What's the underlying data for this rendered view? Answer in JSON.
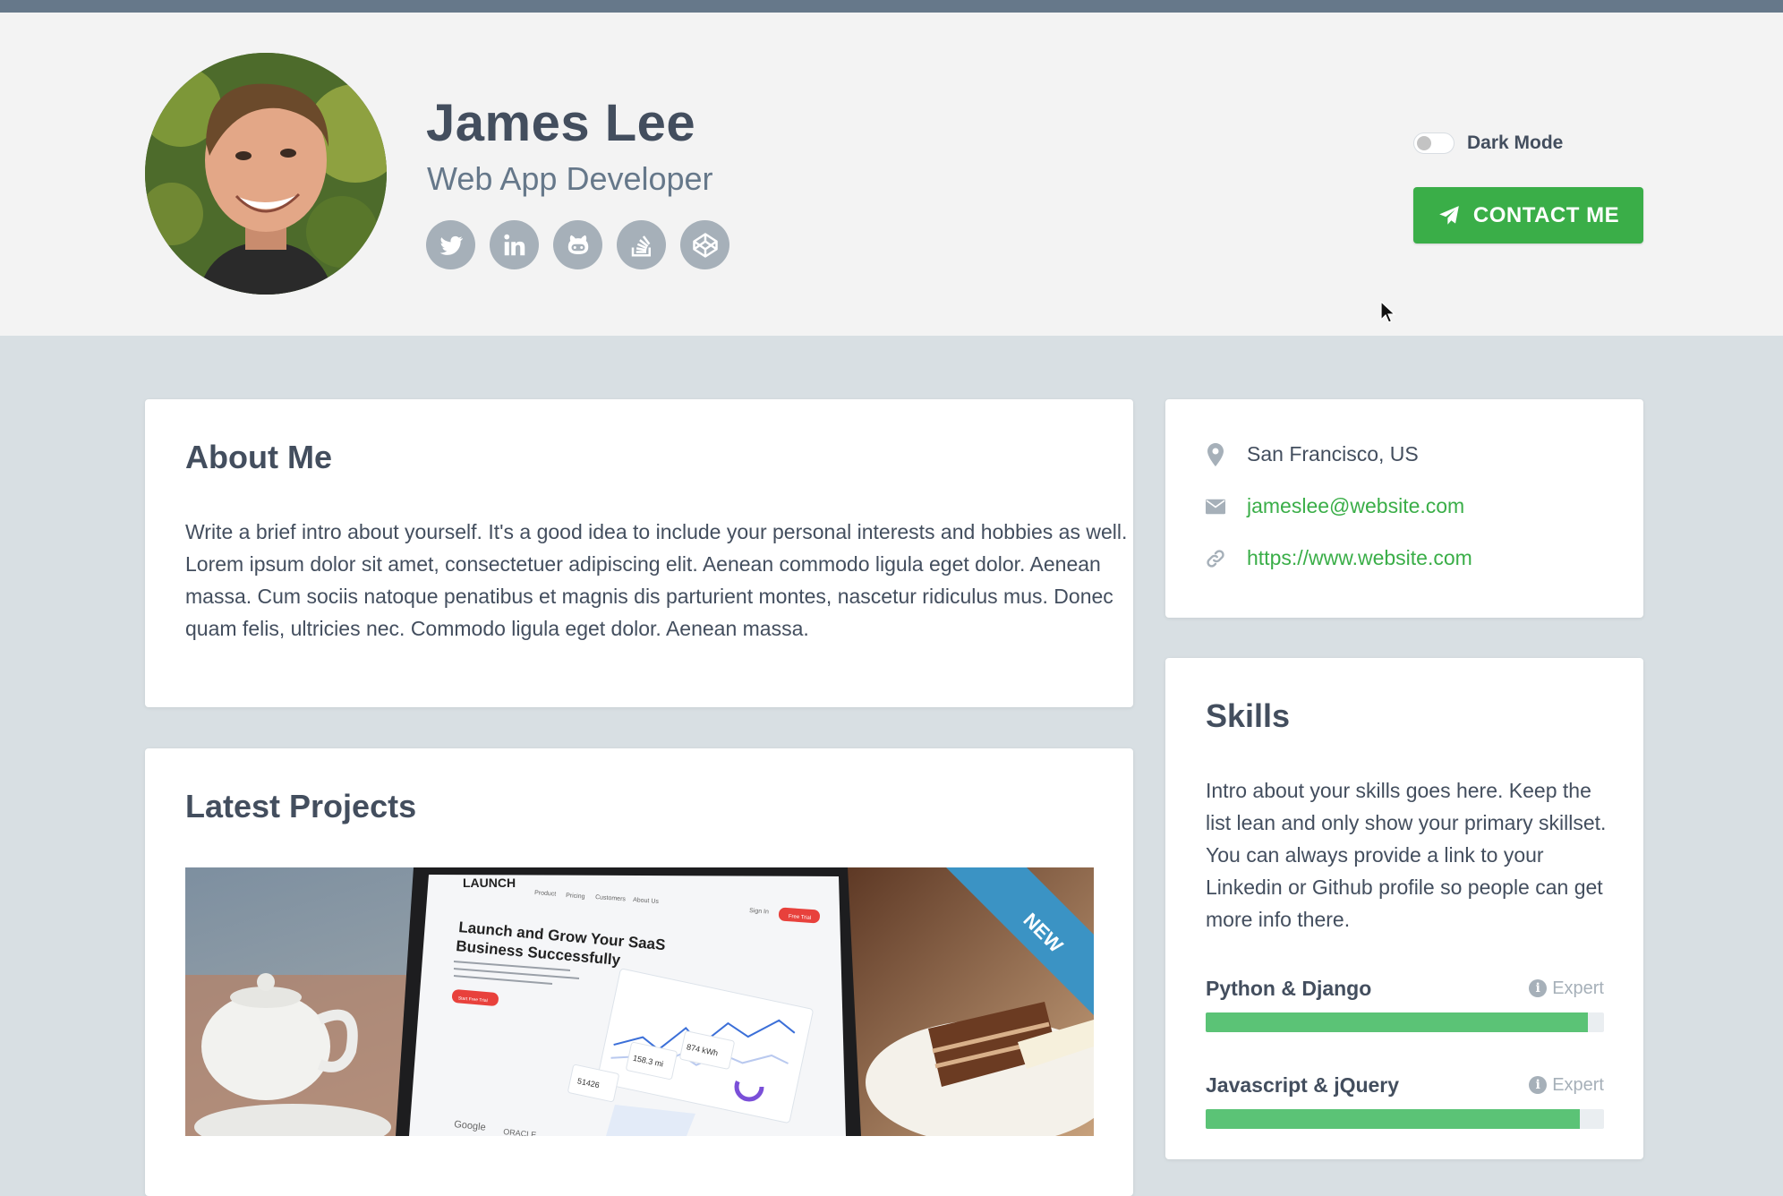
{
  "profile": {
    "name": "James Lee",
    "tagline": "Web App Developer",
    "socials": [
      {
        "icon": "twitter-icon"
      },
      {
        "icon": "linkedin-icon"
      },
      {
        "icon": "github-icon"
      },
      {
        "icon": "stack-overflow-icon"
      },
      {
        "icon": "codepen-icon"
      }
    ]
  },
  "header": {
    "dark_mode_label": "Dark Mode",
    "dark_mode_on": false,
    "contact_label": "CONTACT ME"
  },
  "about": {
    "title": "About Me",
    "text": "Write a brief intro about yourself. It's a good idea to include your personal interests and hobbies as well. Lorem ipsum dolor sit amet, consectetuer adipiscing elit. Aenean commodo ligula eget dolor. Aenean massa. Cum sociis natoque penatibus et magnis dis parturient montes, nascetur ridiculus mus. Donec quam felis, ultricies nec. Commodo ligula eget dolor. Aenean massa."
  },
  "contact_info": {
    "location": "San Francisco, US",
    "email": "jameslee@website.com",
    "website": "https://www.website.com"
  },
  "skills": {
    "title": "Skills",
    "intro": "Intro about your skills goes here. Keep the list lean and only show your primary skillset. You can always provide a link to your Linkedin or Github profile so people can get more info there.",
    "items": [
      {
        "name": "Python & Django",
        "level": "Expert",
        "progress": 0.96
      },
      {
        "name": "Javascript & jQuery",
        "level": "Expert",
        "progress": 0.94
      }
    ]
  },
  "projects": {
    "title": "Latest Projects",
    "featured": {
      "badge": "NEW",
      "screen_brand": "LAUNCH",
      "screen_nav": [
        "Product",
        "Pricing",
        "Customers",
        "About Us"
      ],
      "screen_signin": "Sign In",
      "screen_trial": "Free Trial",
      "screen_headline_1": "Launch and Grow Your SaaS",
      "screen_headline_2": "Business Successfully",
      "screen_cta": "Start Free Trial",
      "screen_stats": [
        "51426",
        "158.3 mi",
        "874 kWh"
      ],
      "screen_logos": [
        "Google",
        "ORACLE"
      ]
    }
  },
  "colors": {
    "accent": "#3aae48",
    "bar_fill": "#5bc376",
    "heading": "#434e5e",
    "muted": "#66788a",
    "badge": "#3b93c4"
  }
}
